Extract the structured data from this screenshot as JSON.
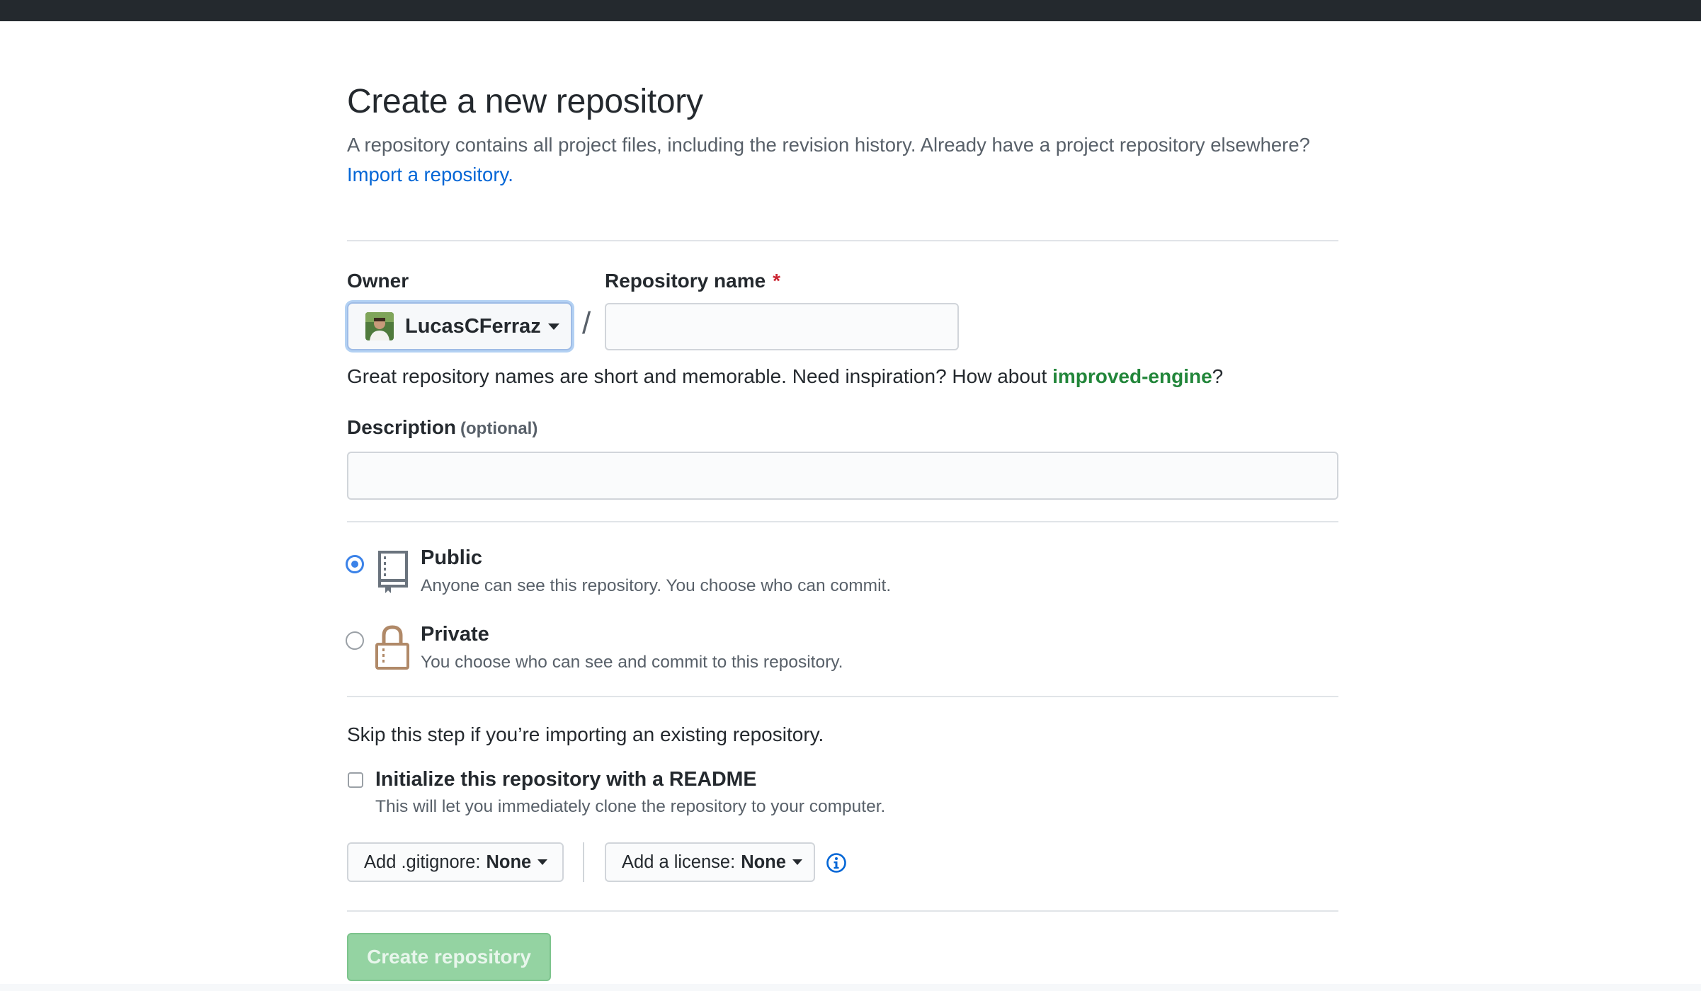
{
  "page": {
    "title": "Create a new repository",
    "subhead_text": "A repository contains all project files, including the revision history. Already have a project repository elsewhere?",
    "import_link": "Import a repository."
  },
  "owner": {
    "label": "Owner",
    "value": "LucasCFerraz"
  },
  "repo_name": {
    "label": "Repository name",
    "required_mark": "*",
    "value": "",
    "placeholder": ""
  },
  "separator": "/",
  "hint": {
    "prefix": "Great repository names are short and memorable. Need inspiration? How about",
    "suggestion": "improved-engine",
    "suffix": "?"
  },
  "description": {
    "label": "Description",
    "optional": "(optional)",
    "value": "",
    "placeholder": ""
  },
  "visibility": {
    "selected": "public",
    "public": {
      "title": "Public",
      "desc": "Anyone can see this repository. You choose who can commit."
    },
    "private": {
      "title": "Private",
      "desc": "You choose who can see and commit to this repository."
    }
  },
  "init": {
    "skip_note": "Skip this step if you’re importing an existing repository.",
    "readme_label": "Initialize this repository with a README",
    "readme_desc": "This will let you immediately clone the repository to your computer.",
    "readme_checked": false
  },
  "gitignore": {
    "label": "Add .gitignore:",
    "value": "None"
  },
  "license": {
    "label": "Add a license:",
    "value": "None"
  },
  "submit": {
    "label": "Create repository",
    "disabled": true
  },
  "colors": {
    "link": "#0366d6",
    "suggestion": "#22863a",
    "required": "#cb2431",
    "button_disabled_bg": "#94d3a2",
    "header_bg": "#24292e"
  },
  "icons": {
    "public": "repo-icon",
    "private": "lock-icon",
    "info": "info-icon",
    "owner_menu": "caret-down-icon"
  }
}
